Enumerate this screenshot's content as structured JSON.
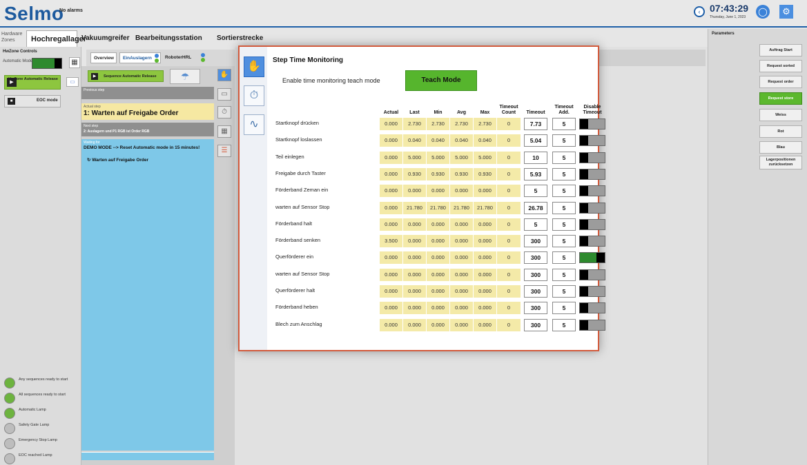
{
  "header": {
    "logo": "Selmo",
    "alarms": "No alarms",
    "time": "07:43:29",
    "date": "Thursday, June 1, 2023",
    "clock_icon": "clock-icon",
    "globe_icon": "globe-icon",
    "settings_icon": "gear-icon"
  },
  "zones": {
    "label": "Hardware Zones",
    "tabs": [
      "Hochregallager",
      "Vakuumgreifer",
      "Bearbeitungsstation",
      "Sortierstrecke"
    ],
    "active": 0
  },
  "hwzone": {
    "title": "HwZone Controls",
    "auto_mode_label": "Automatic Mode",
    "release_label": "HwZone Automatic Release",
    "eoc_label": "EOC mode",
    "lamps": [
      {
        "label": "Any sequences ready to start",
        "state": "on"
      },
      {
        "label": "All sequences ready to start",
        "state": "on"
      },
      {
        "label": "Automatic Lamp",
        "state": "on"
      },
      {
        "label": "Safety Gate Lamp",
        "state": "off"
      },
      {
        "label": "Emergency Stop Lamp",
        "state": "off"
      },
      {
        "label": "EOC reached Lamp",
        "state": "off"
      }
    ]
  },
  "subtabs": {
    "items": [
      "Overview",
      "EinAuslagern",
      "RoboterHRL"
    ],
    "active": 1
  },
  "steps": {
    "seq_release": "Sequence Automatic Release",
    "previous_caption": "Previous step",
    "actual_caption": "Actual step",
    "actual_step": "1: Warten auf Freigabe Order",
    "next_caption": "Next step",
    "next_step": "2: Auslagern und P1 RGB ist Order RGB",
    "waiting_caption": "Waiting for",
    "waiting_main": "DEMO MODE --> Reset Automatic mode in 15 minutes!",
    "waiting_sub": "Warten auf Freigabe Order"
  },
  "params": {
    "title": "Parameters",
    "buttons": [
      "Auftrag Start",
      "Request sorted",
      "Request order",
      "Request store",
      "Weiss",
      "Rot",
      "Blau",
      "Lagerpositionen zurücksetzen"
    ],
    "active_index": 3
  },
  "modal": {
    "title": "Step Time Monitoring",
    "teach_label": "Enable time monitoring teach mode",
    "teach_button": "Teach Mode",
    "columns": [
      "Actual",
      "Last",
      "Min",
      "Avg",
      "Max",
      "Timeout Count",
      "Timeout",
      "Timeout Add.",
      "Disable Timeout"
    ],
    "rows": [
      {
        "name": "Startknopf drücken",
        "actual": "0.000",
        "last": "2.730",
        "min": "2.730",
        "avg": "2.730",
        "max": "2.730",
        "count": "0",
        "timeout": "7.73",
        "add": "5",
        "disabled": false
      },
      {
        "name": "Startknopf loslassen",
        "actual": "0.000",
        "last": "0.040",
        "min": "0.040",
        "avg": "0.040",
        "max": "0.040",
        "count": "0",
        "timeout": "5.04",
        "add": "5",
        "disabled": false
      },
      {
        "name": "Teil einlegen",
        "actual": "0.000",
        "last": "5.000",
        "min": "5.000",
        "avg": "5.000",
        "max": "5.000",
        "count": "0",
        "timeout": "10",
        "add": "5",
        "disabled": false
      },
      {
        "name": "Freigabe durch Taster",
        "actual": "0.000",
        "last": "0.930",
        "min": "0.930",
        "avg": "0.930",
        "max": "0.930",
        "count": "0",
        "timeout": "5.93",
        "add": "5",
        "disabled": false
      },
      {
        "name": "Förderband Zeman ein",
        "actual": "0.000",
        "last": "0.000",
        "min": "0.000",
        "avg": "0.000",
        "max": "0.000",
        "count": "0",
        "timeout": "5",
        "add": "5",
        "disabled": false
      },
      {
        "name": "warten auf Sensor Stop",
        "actual": "0.000",
        "last": "21.780",
        "min": "21.780",
        "avg": "21.780",
        "max": "21.780",
        "count": "0",
        "timeout": "26.78",
        "add": "5",
        "disabled": false
      },
      {
        "name": "Förderband halt",
        "actual": "0.000",
        "last": "0.000",
        "min": "0.000",
        "avg": "0.000",
        "max": "0.000",
        "count": "0",
        "timeout": "5",
        "add": "5",
        "disabled": false
      },
      {
        "name": "Förderband senken",
        "actual": "3.500",
        "last": "0.000",
        "min": "0.000",
        "avg": "0.000",
        "max": "0.000",
        "count": "0",
        "timeout": "300",
        "add": "5",
        "disabled": false
      },
      {
        "name": "Querförderer ein",
        "actual": "0.000",
        "last": "0.000",
        "min": "0.000",
        "avg": "0.000",
        "max": "0.000",
        "count": "0",
        "timeout": "300",
        "add": "5",
        "disabled": true
      },
      {
        "name": "warten auf Sensor Stop",
        "actual": "0.000",
        "last": "0.000",
        "min": "0.000",
        "avg": "0.000",
        "max": "0.000",
        "count": "0",
        "timeout": "300",
        "add": "5",
        "disabled": false
      },
      {
        "name": "Querförderer halt",
        "actual": "0.000",
        "last": "0.000",
        "min": "0.000",
        "avg": "0.000",
        "max": "0.000",
        "count": "0",
        "timeout": "300",
        "add": "5",
        "disabled": false
      },
      {
        "name": "Förderband heben",
        "actual": "0.000",
        "last": "0.000",
        "min": "0.000",
        "avg": "0.000",
        "max": "0.000",
        "count": "0",
        "timeout": "300",
        "add": "5",
        "disabled": false
      },
      {
        "name": "Blech zum Anschlag",
        "actual": "0.000",
        "last": "0.000",
        "min": "0.000",
        "avg": "0.000",
        "max": "0.000",
        "count": "0",
        "timeout": "300",
        "add": "5",
        "disabled": false
      }
    ]
  },
  "colors": {
    "brand": "#1d5a9e",
    "accent_green": "#56b52d",
    "modal_border": "#d25a3c",
    "value_yellow": "#f4eaa8",
    "step_blue": "#7ec8e8"
  }
}
